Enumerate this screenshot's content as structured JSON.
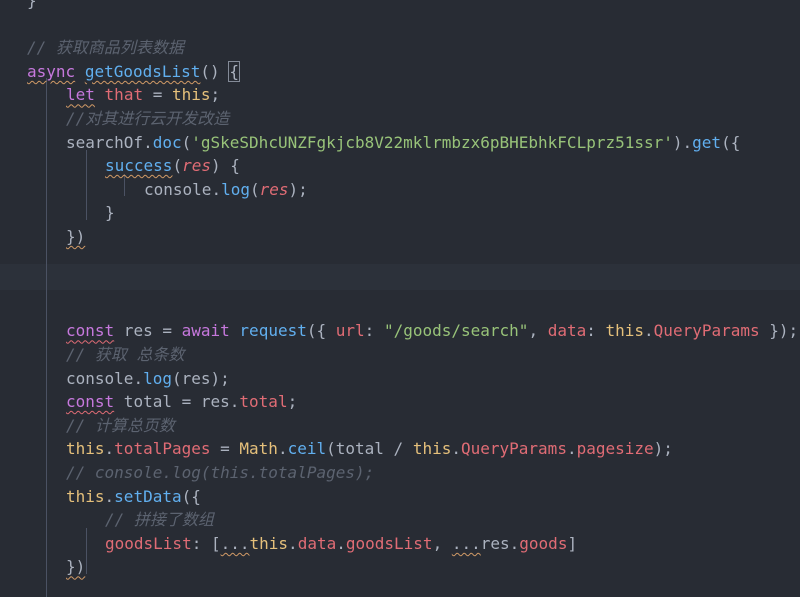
{
  "editor": {
    "lines": [
      {
        "indent": 0,
        "tokens": [
          {
            "t": "}",
            "c": "pl"
          }
        ]
      },
      {
        "indent": 0,
        "tokens": []
      },
      {
        "indent": 0,
        "tokens": [
          {
            "t": "// 获取商品列表数据",
            "c": "cmt"
          }
        ]
      },
      {
        "indent": 0,
        "tokens": [
          {
            "t": "async",
            "c": "kw sq"
          },
          {
            "t": " ",
            "c": "pl"
          },
          {
            "t": "getGoodsList",
            "c": "fn sq"
          },
          {
            "t": "() ",
            "c": "pl"
          },
          {
            "t": "{",
            "c": "pl bracket-box"
          }
        ]
      },
      {
        "indent": 1,
        "tokens": [
          {
            "t": "let",
            "c": "kw sq"
          },
          {
            "t": " ",
            "c": "pl"
          },
          {
            "t": "that",
            "c": "prop"
          },
          {
            "t": " = ",
            "c": "pl"
          },
          {
            "t": "this",
            "c": "cls"
          },
          {
            "t": ";",
            "c": "pl"
          }
        ]
      },
      {
        "indent": 1,
        "tokens": [
          {
            "t": "//对其进行云开发改造",
            "c": "cmt"
          }
        ]
      },
      {
        "indent": 1,
        "tokens": [
          {
            "t": "searchOf",
            "c": "pl"
          },
          {
            "t": ".",
            "c": "pl"
          },
          {
            "t": "doc",
            "c": "fn"
          },
          {
            "t": "(",
            "c": "pl"
          },
          {
            "t": "'gSkeSDhcUNZFgkjcb8V22mklrmbzx6pBHEbhkFCLprz51ssr'",
            "c": "str"
          },
          {
            "t": ").",
            "c": "pl"
          },
          {
            "t": "get",
            "c": "fn"
          },
          {
            "t": "({",
            "c": "pl"
          }
        ]
      },
      {
        "indent": 2,
        "tokens": [
          {
            "t": "success",
            "c": "fn sq"
          },
          {
            "t": "(",
            "c": "pl"
          },
          {
            "t": "res",
            "c": "param"
          },
          {
            "t": ") {",
            "c": "pl"
          }
        ]
      },
      {
        "indent": 3,
        "tokens": [
          {
            "t": "console",
            "c": "pl"
          },
          {
            "t": ".",
            "c": "pl"
          },
          {
            "t": "log",
            "c": "fn"
          },
          {
            "t": "(",
            "c": "pl"
          },
          {
            "t": "res",
            "c": "param"
          },
          {
            "t": ");",
            "c": "pl"
          }
        ]
      },
      {
        "indent": 2,
        "tokens": [
          {
            "t": "}",
            "c": "pl"
          }
        ]
      },
      {
        "indent": 1,
        "tokens": [
          {
            "t": "})",
            "c": "pl sq"
          }
        ]
      },
      {
        "indent": 0,
        "tokens": []
      },
      {
        "indent": 0,
        "tokens": []
      },
      {
        "indent": 0,
        "tokens": []
      },
      {
        "indent": 1,
        "tokens": [
          {
            "t": "const",
            "c": "kw sqr"
          },
          {
            "t": " res = ",
            "c": "pl"
          },
          {
            "t": "await",
            "c": "kw"
          },
          {
            "t": " ",
            "c": "pl"
          },
          {
            "t": "request",
            "c": "fn"
          },
          {
            "t": "({ ",
            "c": "pl"
          },
          {
            "t": "url",
            "c": "prop"
          },
          {
            "t": ": ",
            "c": "pl"
          },
          {
            "t": "\"/goods/search\"",
            "c": "str"
          },
          {
            "t": ", ",
            "c": "pl"
          },
          {
            "t": "data",
            "c": "prop"
          },
          {
            "t": ": ",
            "c": "pl"
          },
          {
            "t": "this",
            "c": "cls"
          },
          {
            "t": ".",
            "c": "pl"
          },
          {
            "t": "QueryParams",
            "c": "prop"
          },
          {
            "t": " });",
            "c": "pl"
          }
        ]
      },
      {
        "indent": 1,
        "tokens": [
          {
            "t": "// 获取 总条数",
            "c": "cmt"
          }
        ]
      },
      {
        "indent": 1,
        "tokens": [
          {
            "t": "console",
            "c": "pl"
          },
          {
            "t": ".",
            "c": "pl"
          },
          {
            "t": "log",
            "c": "fn"
          },
          {
            "t": "(res);",
            "c": "pl"
          }
        ]
      },
      {
        "indent": 1,
        "tokens": [
          {
            "t": "const",
            "c": "kw sqr"
          },
          {
            "t": " total = res.",
            "c": "pl"
          },
          {
            "t": "total",
            "c": "prop"
          },
          {
            "t": ";",
            "c": "pl"
          }
        ]
      },
      {
        "indent": 1,
        "tokens": [
          {
            "t": "// 计算总页数",
            "c": "cmt"
          }
        ]
      },
      {
        "indent": 1,
        "tokens": [
          {
            "t": "this",
            "c": "cls"
          },
          {
            "t": ".",
            "c": "pl"
          },
          {
            "t": "totalPages",
            "c": "prop"
          },
          {
            "t": " = ",
            "c": "pl"
          },
          {
            "t": "Math",
            "c": "cls"
          },
          {
            "t": ".",
            "c": "pl"
          },
          {
            "t": "ceil",
            "c": "fn"
          },
          {
            "t": "(total / ",
            "c": "pl"
          },
          {
            "t": "this",
            "c": "cls"
          },
          {
            "t": ".",
            "c": "pl"
          },
          {
            "t": "QueryParams",
            "c": "prop"
          },
          {
            "t": ".",
            "c": "pl"
          },
          {
            "t": "pagesize",
            "c": "prop"
          },
          {
            "t": ");",
            "c": "pl"
          }
        ]
      },
      {
        "indent": 1,
        "tokens": [
          {
            "t": "// console.log(this.totalPages);",
            "c": "cmt"
          }
        ]
      },
      {
        "indent": 1,
        "tokens": [
          {
            "t": "this",
            "c": "cls"
          },
          {
            "t": ".",
            "c": "pl"
          },
          {
            "t": "setData",
            "c": "fn"
          },
          {
            "t": "({",
            "c": "pl"
          }
        ]
      },
      {
        "indent": 2,
        "tokens": [
          {
            "t": "// 拼接了数组",
            "c": "cmt"
          }
        ]
      },
      {
        "indent": 2,
        "tokens": [
          {
            "t": "goodsList",
            "c": "prop"
          },
          {
            "t": ": [",
            "c": "pl"
          },
          {
            "t": "...",
            "c": "pl sq"
          },
          {
            "t": "this",
            "c": "cls"
          },
          {
            "t": ".",
            "c": "pl"
          },
          {
            "t": "data",
            "c": "prop"
          },
          {
            "t": ".",
            "c": "pl"
          },
          {
            "t": "goodsList",
            "c": "prop"
          },
          {
            "t": ", ",
            "c": "pl"
          },
          {
            "t": "...",
            "c": "pl sq"
          },
          {
            "t": "res",
            "c": "pl"
          },
          {
            "t": ".",
            "c": "pl"
          },
          {
            "t": "goods",
            "c": "prop"
          },
          {
            "t": "]",
            "c": "pl"
          }
        ]
      },
      {
        "indent": 1,
        "tokens": [
          {
            "t": "})",
            "c": "pl sq"
          }
        ]
      }
    ]
  }
}
